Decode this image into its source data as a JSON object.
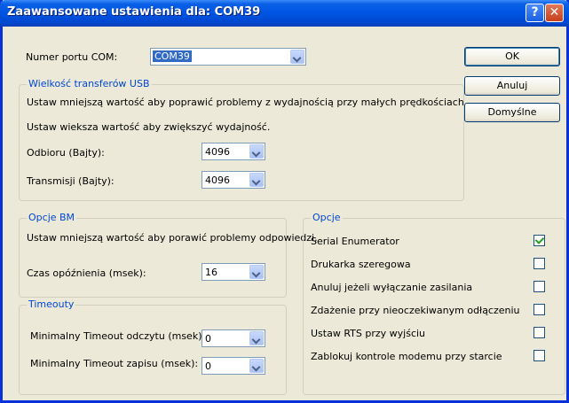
{
  "window": {
    "title": "Zaawansowane ustawienia dla: COM39"
  },
  "titlebar_buttons": {
    "help": "?",
    "close": "✕"
  },
  "port": {
    "label": "Numer portu COM:",
    "value": "COM39"
  },
  "usb_group": {
    "title": "Wielkość transferów USB",
    "hint_lower": "Ustaw mniejszą wartość aby poprawić problemy z wydajnością przy małych prędkościach.",
    "hint_higher": "Ustaw wieksza wartość aby zwiększyć wydajność.",
    "rx_label": "Odbioru (Bajty):",
    "rx_value": "4096",
    "tx_label": "Transmisji (Bajty):",
    "tx_value": "4096"
  },
  "bm_group": {
    "title": "Opcje BM",
    "hint": "Ustaw mniejszą wartość aby porawić problemy odpowiedzi.",
    "latency_label": "Czas opóźnienia (msek):",
    "latency_value": "16"
  },
  "timeouts_group": {
    "title": "Timeouty",
    "read_label": "Minimalny Timeout odczytu (msek):",
    "read_value": "0",
    "write_label": "Minimalny Timeout zapisu (msek):",
    "write_value": "0"
  },
  "options_group": {
    "title": "Opcje",
    "items": [
      {
        "label": "Serial Enumerator",
        "checked": true
      },
      {
        "label": "Drukarka szeregowa",
        "checked": false
      },
      {
        "label": "Anuluj jeżeli wyłączanie zasilania",
        "checked": false
      },
      {
        "label": "Zdażenie przy nieoczekiwanym odłączeniu",
        "checked": false
      },
      {
        "label": "Ustaw RTS przy wyjściu",
        "checked": false
      },
      {
        "label": "Zablokuj kontrole modemu przy starcie",
        "checked": false
      }
    ]
  },
  "buttons": {
    "ok": "OK",
    "cancel": "Anuluj",
    "defaults": "Domyślne"
  }
}
